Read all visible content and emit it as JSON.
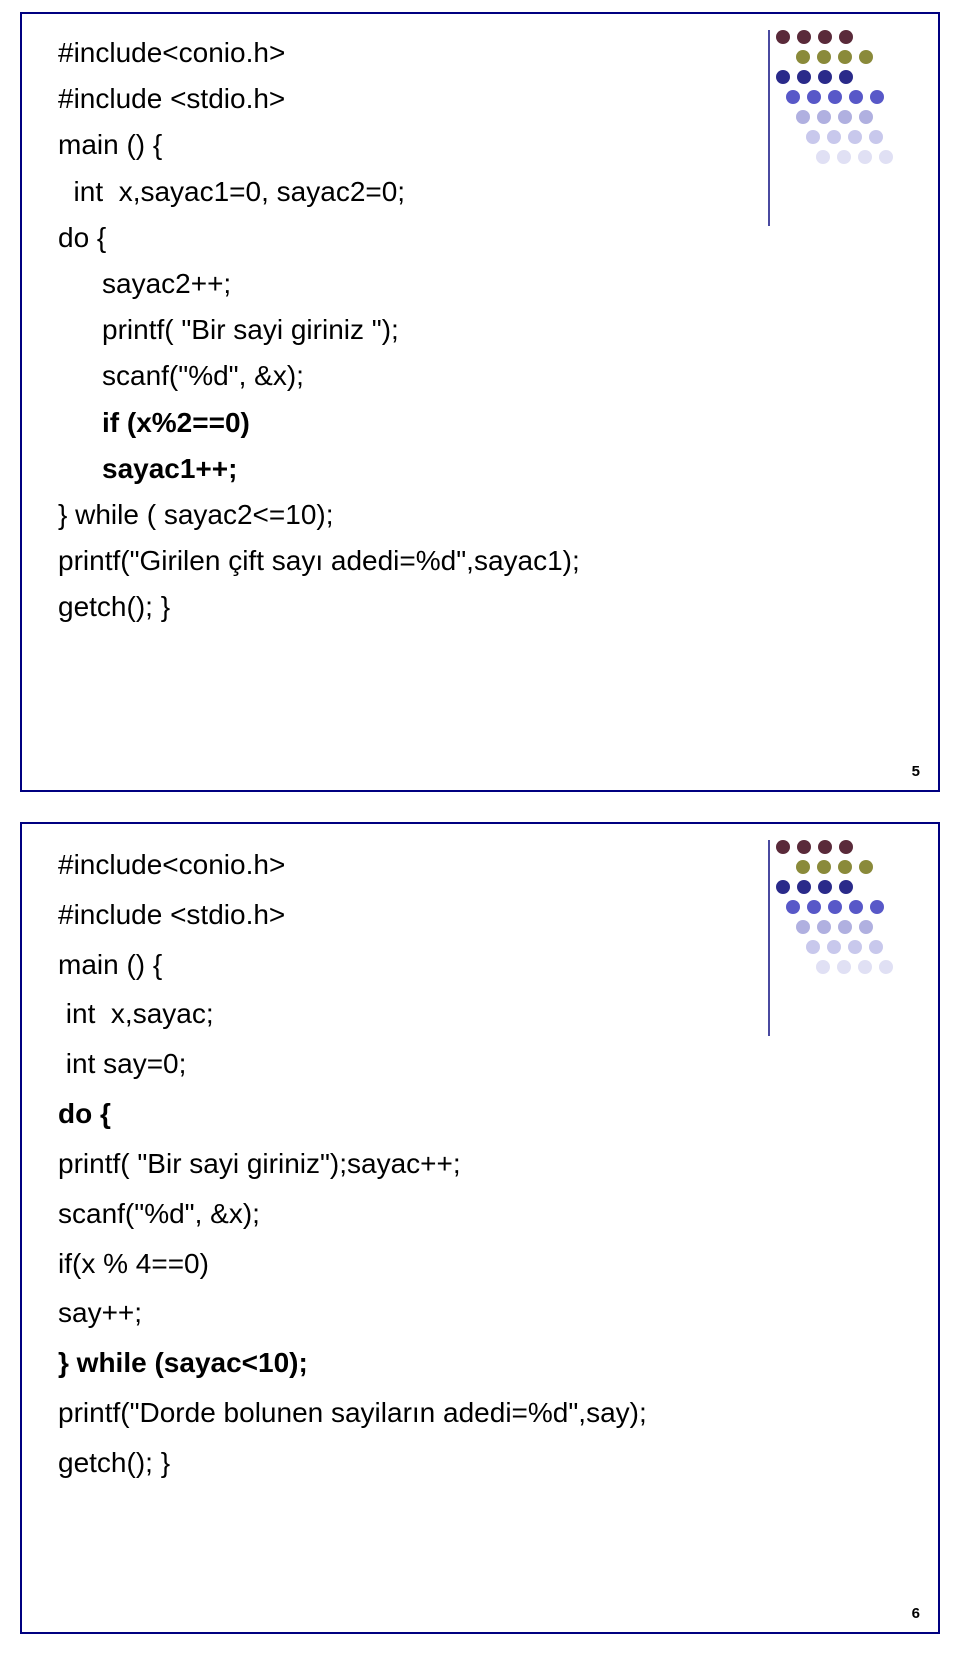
{
  "slide1": {
    "lines": [
      "#include<conio.h>",
      "#include <stdio.h>",
      "main () {",
      "  int  x,sayac1=0, sayac2=0;",
      "do {",
      "sayac2++;",
      "printf( \"Bir sayi giriniz \");",
      "scanf(\"%d\", &x);",
      "if (x%2==0)",
      "sayac1++;",
      "} while ( sayac2<=10);",
      "printf(\"Girilen çift sayı adedi=%d\",sayac1);",
      "getch(); }"
    ],
    "pagenum": "5"
  },
  "slide2": {
    "lines": [
      "#include<conio.h>",
      "#include <stdio.h>",
      "main () {",
      " int  x,sayac;",
      " int say=0;",
      "do {",
      "printf( \"Bir sayi giriniz\");sayac++;",
      "scanf(\"%d\", &x);",
      "if(x % 4==0)",
      "say++;",
      "} while (sayac<10);",
      "printf(\"Dorde bolunen sayiların adedi=%d\",say);",
      "getch(); }"
    ],
    "pagenum": "6"
  }
}
